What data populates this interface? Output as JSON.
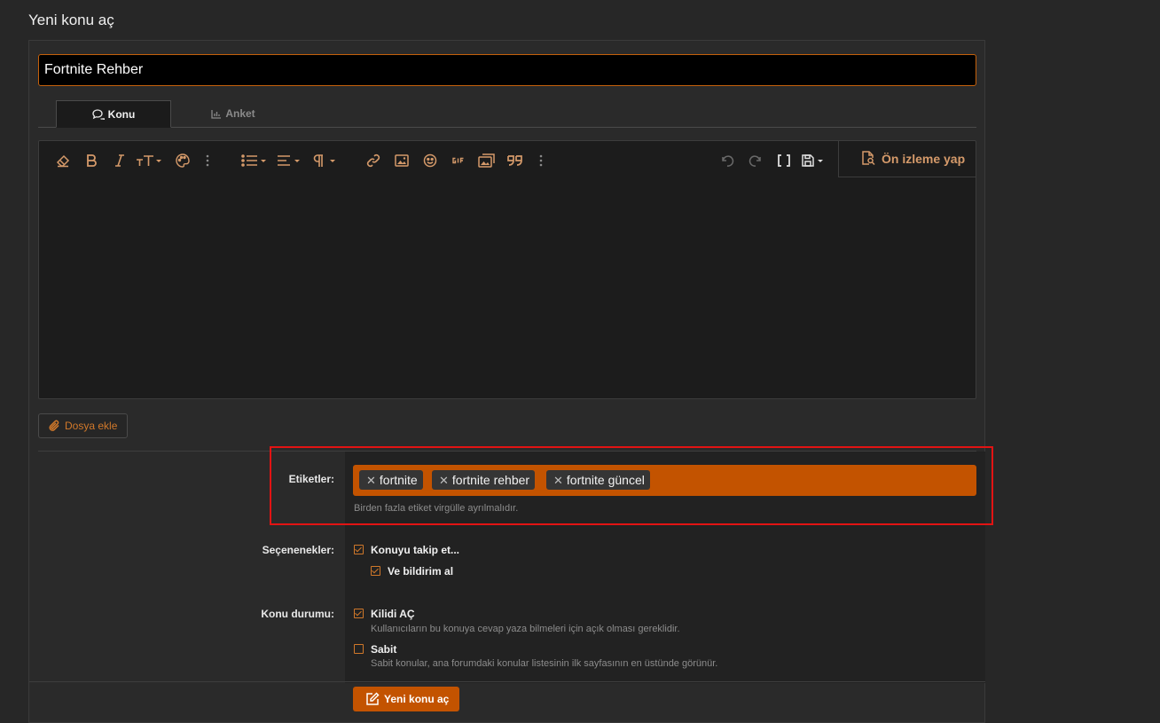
{
  "page_title": "Yeni konu aç",
  "thread_title": "Fortnite Rehber",
  "tabs": [
    {
      "label": "Konu",
      "icon": "comments-icon",
      "active": true
    },
    {
      "label": "Anket",
      "icon": "bar-chart-icon",
      "active": false
    }
  ],
  "editor": {
    "toolbar": [
      "eraser-icon",
      "bold-icon",
      "italic-icon",
      "text-size-icon",
      "palette-icon",
      "more-icon",
      "list-icon",
      "align-icon",
      "paragraph-icon",
      "link-icon",
      "image-icon",
      "smilie-icon",
      "gif-icon",
      "media-icon",
      "quote-icon",
      "more-icon",
      "undo-icon",
      "redo-icon",
      "bbcode-icon",
      "drafts-icon"
    ],
    "preview_label": "Ön izleme yap"
  },
  "attach_label": "Dosya ekle",
  "tags": {
    "label": "Etiketler:",
    "items": [
      "fortnite",
      "fortnite rehber",
      "fortnite güncel"
    ],
    "hint": "Birden fazla etiket virgülle ayrılmalıdır."
  },
  "options": {
    "label": "Seçenenekler:",
    "watch": {
      "label": "Konuyu takip et...",
      "checked": true
    },
    "notify": {
      "label": "Ve bildirim al",
      "checked": true
    }
  },
  "status": {
    "label": "Konu durumu:",
    "open": {
      "label": "Kilidi AÇ",
      "checked": true,
      "desc": "Kullanıcıların bu konuya cevap yaza bilmeleri için açık olması gereklidir."
    },
    "sticky": {
      "label": "Sabit",
      "checked": false,
      "desc": "Sabit konular, ana forumdaki konular listesinin ilk sayfasının en üstünde görünür."
    }
  },
  "submit_label": "Yeni konu aç",
  "colors": {
    "accent": "#c35300",
    "highlight": "#e21313",
    "background": "#272727"
  }
}
